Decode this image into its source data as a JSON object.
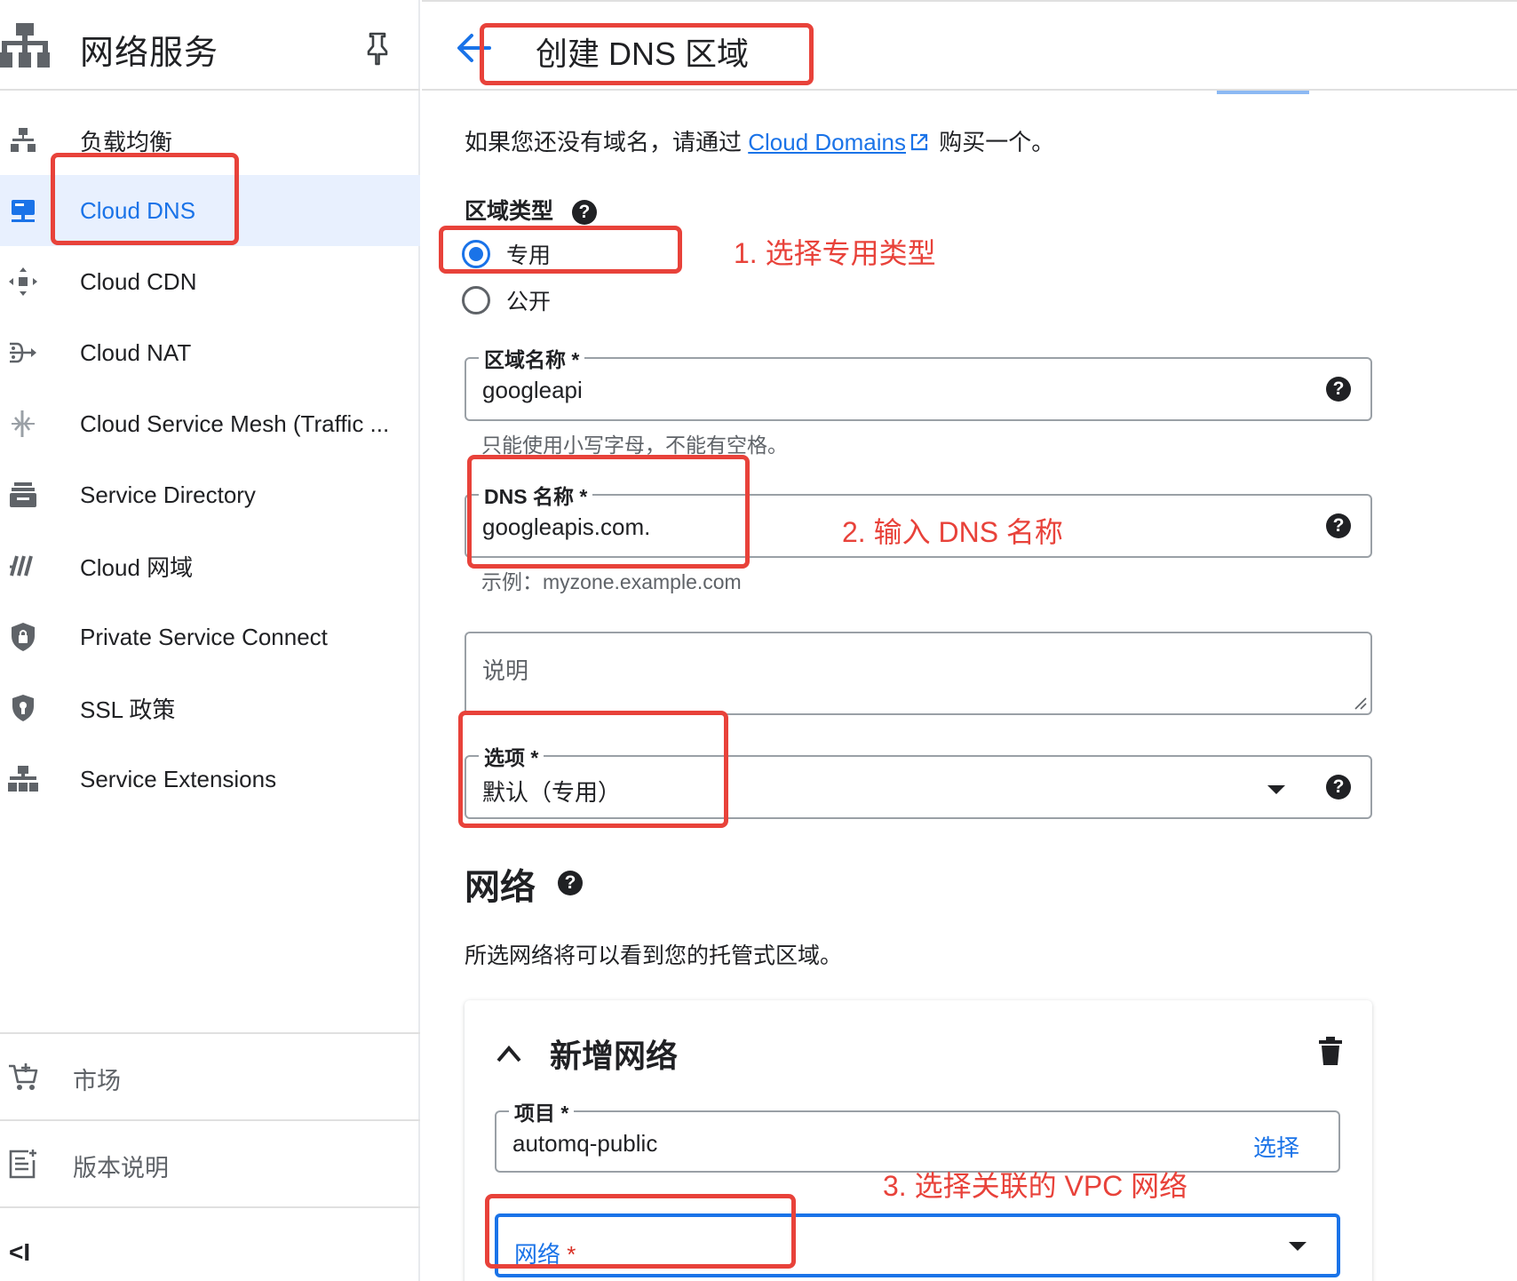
{
  "sidebar": {
    "title": "网络服务",
    "items": [
      {
        "label": "负载均衡",
        "icon": "load-balancing-icon"
      },
      {
        "label": "Cloud DNS",
        "icon": "dns-icon",
        "active": true
      },
      {
        "label": "Cloud CDN",
        "icon": "cdn-icon"
      },
      {
        "label": "Cloud NAT",
        "icon": "nat-icon"
      },
      {
        "label": "Cloud Service Mesh (Traffic ...",
        "icon": "service-mesh-icon"
      },
      {
        "label": "Service Directory",
        "icon": "service-directory-icon"
      },
      {
        "label": "Cloud 网域",
        "icon": "domains-icon"
      },
      {
        "label": "Private Service Connect",
        "icon": "private-service-connect-icon"
      },
      {
        "label": "SSL 政策",
        "icon": "ssl-policy-icon"
      },
      {
        "label": "Service Extensions",
        "icon": "service-extensions-icon"
      }
    ],
    "bottom": [
      {
        "label": "市场",
        "icon": "marketplace-cart-icon"
      },
      {
        "label": "版本说明",
        "icon": "release-notes-icon"
      }
    ],
    "collapse": "<I"
  },
  "header": {
    "title": "创建 DNS 区域"
  },
  "intro": {
    "before": "如果您还没有域名，请通过 ",
    "link": "Cloud Domains",
    "after": " 购买一个。"
  },
  "zone_type": {
    "label": "区域类型",
    "options": [
      {
        "label": "专用",
        "checked": true
      },
      {
        "label": "公开",
        "checked": false
      }
    ]
  },
  "zone_name": {
    "label": "区域名称 *",
    "value": "googleapi",
    "hint": "只能使用小写字母，不能有空格。"
  },
  "dns_name": {
    "label": "DNS 名称 *",
    "value": "googleapis.com.",
    "hint": "示例：myzone.example.com"
  },
  "description": {
    "placeholder": "说明"
  },
  "options_field": {
    "label": "选项 *",
    "value": "默认（专用）"
  },
  "network_section": {
    "title": "网络",
    "desc": "所选网络将可以看到您的托管式区域。",
    "card_title": "新增网络",
    "project": {
      "label": "项目 *",
      "value": "automq-public",
      "action": "选择"
    },
    "network": {
      "label": "网络",
      "required_mark": "*"
    }
  },
  "annotations": {
    "step1": "1. 选择专用类型",
    "step2": "2. 输入 DNS 名称",
    "step3": "3. 选择关联的 VPC 网络"
  },
  "help_glyph": "?",
  "colors": {
    "accent": "#1a73e8",
    "annotation": "#e8423a",
    "active_bg": "#e8f0fe"
  }
}
